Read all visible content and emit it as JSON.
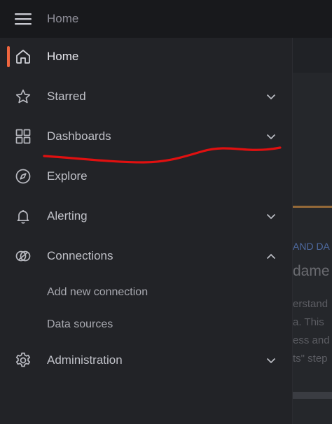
{
  "topbar": {
    "breadcrumb": "Home"
  },
  "background_hints": {
    "line1": "AND DA",
    "line2": "dame",
    "line3": "erstand",
    "line4": "a. This",
    "line5": "ess and",
    "line6": "ts\" step"
  },
  "menu": {
    "items": [
      {
        "label": "Home",
        "icon": "home-icon",
        "active": true
      },
      {
        "label": "Starred",
        "icon": "star-icon",
        "chevron": "down"
      },
      {
        "label": "Dashboards",
        "icon": "apps-grid-icon",
        "chevron": "down"
      },
      {
        "label": "Explore",
        "icon": "compass-icon"
      },
      {
        "label": "Alerting",
        "icon": "bell-icon",
        "chevron": "down"
      },
      {
        "label": "Connections",
        "icon": "connections-icon",
        "chevron": "up",
        "children": [
          {
            "label": "Add new connection"
          },
          {
            "label": "Data sources"
          }
        ]
      },
      {
        "label": "Administration",
        "icon": "cog-icon",
        "chevron": "down"
      }
    ]
  },
  "colors": {
    "accent": "#f0663f",
    "annotation": "#e01010"
  }
}
